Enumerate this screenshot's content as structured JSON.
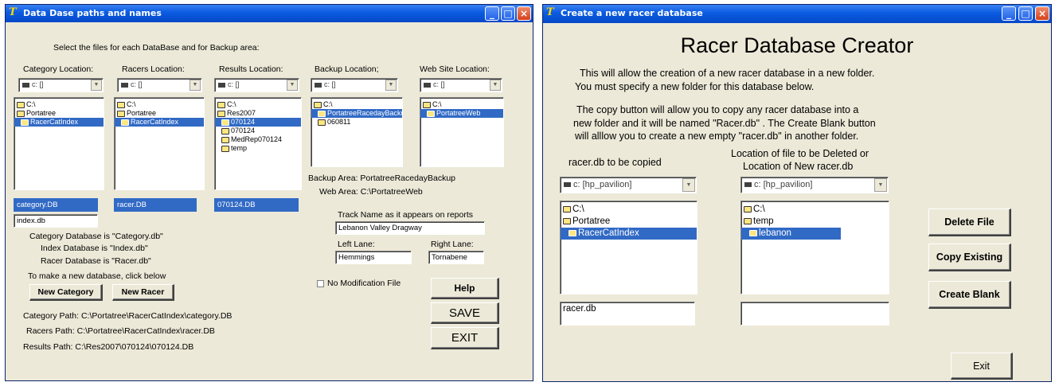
{
  "left_window": {
    "title": "Data Dase paths and names",
    "instruction": "Select the files for each DataBase and for Backup area:",
    "columns": [
      {
        "header": "Category Location:",
        "drive": "c: []",
        "tree": [
          "C:\\",
          "Portatree",
          "RacerCatIndex"
        ],
        "selected": 2,
        "file": "category.DB"
      },
      {
        "header": "Racers Location:",
        "drive": "c: []",
        "tree": [
          "C:\\",
          "Portatree",
          "RacerCatIndex"
        ],
        "selected": 2,
        "file": "racer.DB"
      },
      {
        "header": "Results Location:",
        "drive": "c: []",
        "tree": [
          "C:\\",
          "Res2007",
          "070124",
          "070124",
          "MedRep070124",
          "temp"
        ],
        "selected": 2,
        "file": "070124.DB"
      },
      {
        "header": "Backup Location;",
        "drive": "c: []",
        "tree": [
          "C:\\",
          "PortatreeRacedayBacku",
          "060811"
        ],
        "selected": 1
      },
      {
        "header": "Web Site Location:",
        "drive": "c: []",
        "tree": [
          "C:\\",
          "PortatreeWeb"
        ],
        "selected": 1
      }
    ],
    "index_field": "index.db",
    "info_lines": [
      "Category Database is \"Category.db\"",
      "Index Database is \"Index.db\"",
      "Racer Database is \"Racer.db\""
    ],
    "new_db_hint": "To make a new database, click below",
    "new_category_label": "New Category",
    "new_racer_label": "New Racer",
    "paths": [
      "Category Path: C:\\Portatree\\RacerCatIndex\\category.DB",
      "Racers Path: C:\\Portatree\\RacerCatIndex\\racer.DB",
      "Results Path: C:\\Res2007\\070124\\070124.DB"
    ],
    "backup_area": "Backup Area: PortatreeRacedayBackup",
    "web_area": "Web Area: C:\\PortatreeWeb",
    "track_label": "Track Name as it appears on reports",
    "track_name": "Lebanon Valley Dragway",
    "left_lane_label": "Left Lane:",
    "right_lane_label": "Right Lane:",
    "left_lane": "Hemmings",
    "right_lane": "Tornabene",
    "no_mod_label": "No Modification File",
    "help_label": "Help",
    "save_label": "SAVE",
    "exit_label": "EXIT"
  },
  "right_window": {
    "title": "Create a new racer database",
    "heading": "Racer Database Creator",
    "desc1": [
      "This will allow the creation of a new racer database in a new folder.",
      "You must specify a new folder for this database below."
    ],
    "desc2": [
      "The copy button will allow you to copy any racer database into a",
      "new folder and it will be named \"Racer.db\" . The Create Blank button",
      "will alllow you  to create a new empty \"racer.db\" in another folder."
    ],
    "copy_label": "racer.db to be copied",
    "target_label_1": "Location of file to be Deleted or",
    "target_label_2": "Location of New racer.db",
    "drive_left": "c: [hp_pavilion]",
    "drive_right": "c: [hp_pavilion]",
    "tree_left": [
      "C:\\",
      "Portatree",
      "RacerCatIndex"
    ],
    "tree_left_selected": 2,
    "tree_right": [
      "C:\\",
      "temp",
      "lebanon"
    ],
    "tree_right_selected": 2,
    "file_left": "racer.db",
    "file_right": "",
    "delete_label": "Delete File",
    "copy_existing_label": "Copy Existing",
    "create_blank_label": "Create Blank",
    "exit_label": "Exit"
  }
}
